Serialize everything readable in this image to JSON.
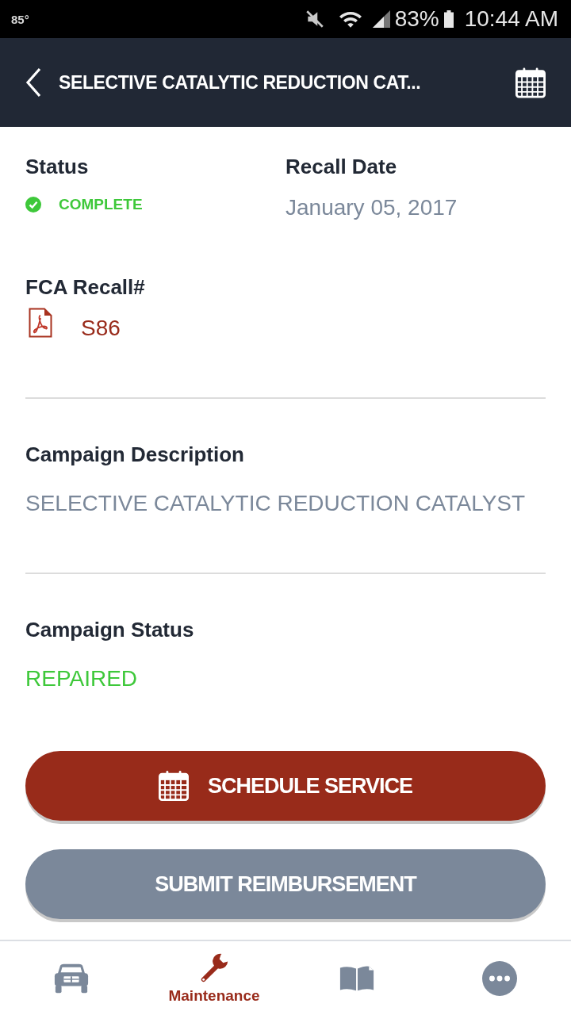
{
  "status_bar": {
    "temperature": "85°",
    "battery_percent": "83%",
    "time": "10:44 AM"
  },
  "header": {
    "title": "SELECTIVE CATALYTIC REDUCTION CAT..."
  },
  "details": {
    "status": {
      "label": "Status",
      "value": "COMPLETE"
    },
    "recall_date": {
      "label": "Recall Date",
      "value": "January 05, 2017"
    },
    "fca_recall": {
      "label": "FCA Recall#",
      "value": "S86"
    },
    "campaign_description": {
      "label": "Campaign Description",
      "value": "SELECTIVE CATALYTIC REDUCTION CATALYST"
    },
    "campaign_status": {
      "label": "Campaign Status",
      "value": "REPAIRED"
    }
  },
  "buttons": [
    {
      "kind": "primary",
      "label": "SCHEDULE SERVICE"
    },
    {
      "kind": "secondary",
      "label": "SUBMIT REIMBURSEMENT"
    }
  ],
  "bottom_nav": [
    {
      "kind": "vehicle",
      "selected": false
    },
    {
      "kind": "maintenance",
      "label": "Maintenance",
      "selected": true
    },
    {
      "kind": "manual",
      "selected": false
    },
    {
      "kind": "more",
      "selected": false
    }
  ]
}
